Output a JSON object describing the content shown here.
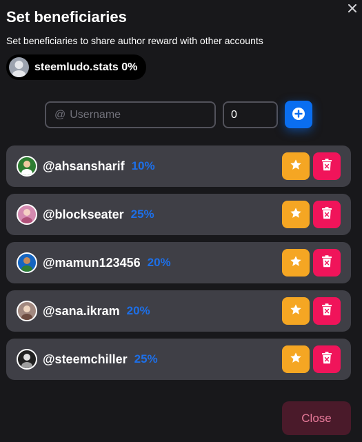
{
  "dialog": {
    "title": "Set beneficiaries",
    "subtitle": "Set beneficiaries to share author reward with other accounts"
  },
  "author": {
    "label": "steemludo.stats 0%"
  },
  "form": {
    "username_placeholder": "Username",
    "at_symbol": "@",
    "weight_value": "0"
  },
  "beneficiaries": [
    {
      "name": "@ahsansharif",
      "weight": "10%",
      "avatar_color": "#2e7d32"
    },
    {
      "name": "@blockseater",
      "weight": "25%",
      "avatar_color": "#d48ab0"
    },
    {
      "name": "@mamun123456",
      "weight": "20%",
      "avatar_color": "#1565c0"
    },
    {
      "name": "@sana.ikram",
      "weight": "20%",
      "avatar_color": "#a1887f"
    },
    {
      "name": "@steemchiller",
      "weight": "25%",
      "avatar_color": "#212121"
    }
  ],
  "footer": {
    "close_label": "Close"
  },
  "colors": {
    "background": "#18181b",
    "row": "#3f3f46",
    "accent_blue": "#0a6ef0",
    "star": "#f5a623",
    "delete": "#f0145a",
    "weight_text": "#1d6fe8"
  },
  "icons": {
    "close": "close-icon",
    "add": "plus-circle-icon",
    "star": "star-icon",
    "delete": "trash-icon",
    "avatar": "avatar-icon"
  }
}
